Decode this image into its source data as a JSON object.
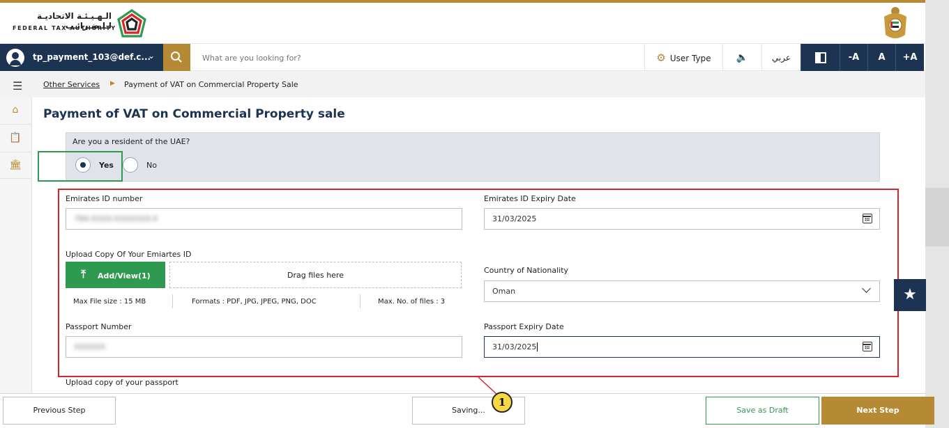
{
  "header": {
    "logo_arabic": "الـهـيـئـة الاتحاديـة لـلـضـرائـب",
    "logo_english": "FEDERAL TAX AUTHORITY"
  },
  "navbar": {
    "user_email": "tp_payment_103@def.c...",
    "search_placeholder": "What are you looking for?",
    "user_type_label": "User Type",
    "language_label": "عربي",
    "font_decrease": "-A",
    "font_normal": "A",
    "font_increase": "+A"
  },
  "breadcrumb": {
    "parent": "Other Services",
    "current": "Payment of VAT on Commercial Property Sale"
  },
  "page": {
    "title": "Payment of VAT on Commercial Property sale"
  },
  "resident": {
    "question": "Are you a resident of the UAE?",
    "options": [
      {
        "label": "Yes",
        "selected": true
      },
      {
        "label": "No",
        "selected": false
      }
    ]
  },
  "form": {
    "emirates_id_label": "Emirates ID number",
    "emirates_id_value": "784-XXXX-XXXXXXX-X",
    "emirates_expiry_label": "Emirates ID Expiry Date",
    "emirates_expiry_value": "31/03/2025",
    "upload_emirates_label": "Upload Copy Of Your Emiartes ID",
    "add_view_label": "Add/View(1)",
    "drag_files_label": "Drag files here",
    "max_file_size": "Max File size : 15 MB",
    "formats": "Formats : PDF, JPG, JPEG, PNG, DOC",
    "max_files": "Max. No. of files : 3",
    "nationality_label": "Country of Nationality",
    "nationality_value": "Oman",
    "passport_number_label": "Passport Number",
    "passport_number_value": "XXXXXX",
    "passport_expiry_label": "Passport Expiry Date",
    "passport_expiry_value": "31/03/2025",
    "upload_passport_label": "Upload copy of your passport"
  },
  "footer": {
    "previous": "Previous Step",
    "saving": "Saving...",
    "save_draft": "Save as Draft",
    "next": "Next Step"
  },
  "callout": {
    "number": "1"
  },
  "colors": {
    "navy": "#1c3452",
    "gold": "#b68a35",
    "green": "#2e9a4f",
    "red_highlight": "#d9252a",
    "callout_yellow": "#f7d744"
  }
}
